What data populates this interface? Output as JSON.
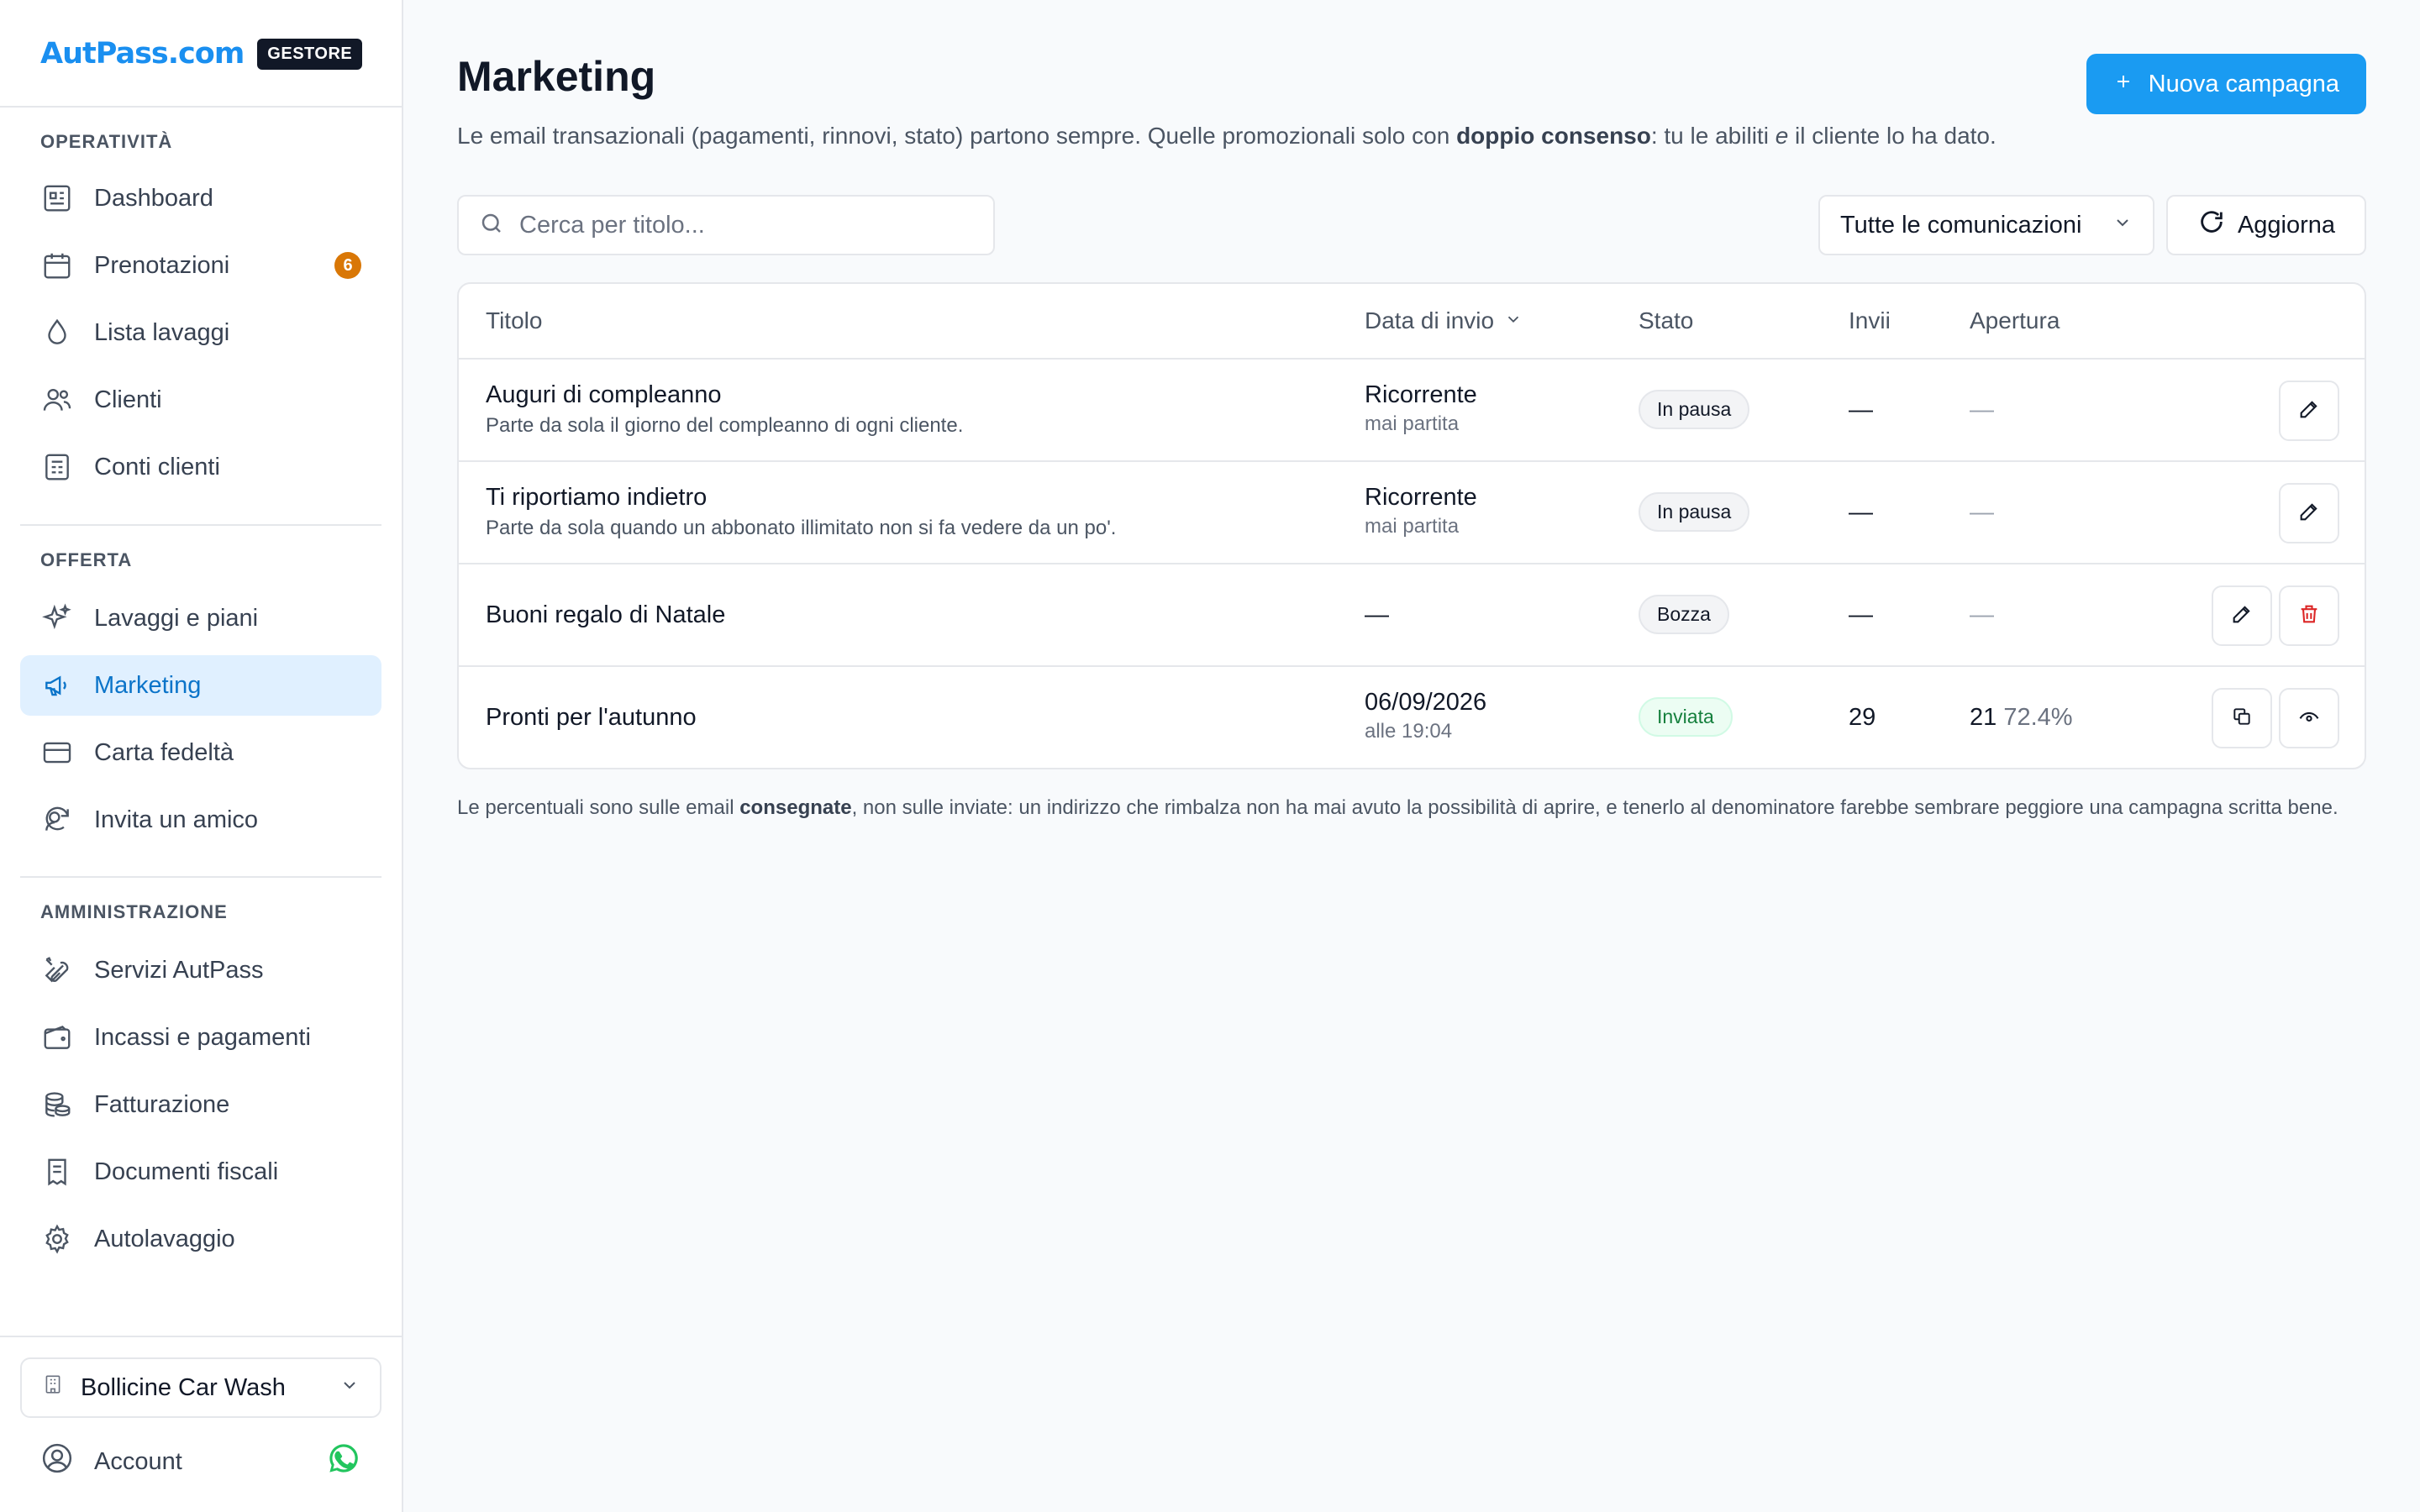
{
  "brand": {
    "logo": "AutPass.com",
    "badge": "GESTORE"
  },
  "sidebar": {
    "sections": [
      {
        "label": "OPERATIVITÀ",
        "items": [
          {
            "label": "Dashboard",
            "icon": "dashboard-icon"
          },
          {
            "label": "Prenotazioni",
            "icon": "calendar-icon",
            "badge": "6"
          },
          {
            "label": "Lista lavaggi",
            "icon": "droplet-icon"
          },
          {
            "label": "Clienti",
            "icon": "users-icon"
          },
          {
            "label": "Conti clienti",
            "icon": "ledger-icon"
          }
        ]
      },
      {
        "label": "OFFERTA",
        "items": [
          {
            "label": "Lavaggi e piani",
            "icon": "sparkles-icon"
          },
          {
            "label": "Marketing",
            "icon": "megaphone-icon",
            "active": true
          },
          {
            "label": "Carta fedeltà",
            "icon": "credit-card-icon"
          },
          {
            "label": "Invita un amico",
            "icon": "refer-friend-icon"
          }
        ]
      },
      {
        "label": "AMMINISTRAZIONE",
        "items": [
          {
            "label": "Servizi AutPass",
            "icon": "tools-icon"
          },
          {
            "label": "Incassi e pagamenti",
            "icon": "wallet-icon"
          },
          {
            "label": "Fatturazione",
            "icon": "coins-icon"
          },
          {
            "label": "Documenti fiscali",
            "icon": "receipt-icon"
          },
          {
            "label": "Autolavaggio",
            "icon": "gear-icon"
          }
        ]
      }
    ],
    "location": "Bollicine Car Wash",
    "account": "Account"
  },
  "header": {
    "title": "Marketing",
    "subtitle_1": "Le email transazionali (pagamenti, rinnovi, stato) partono sempre. Quelle promozionali solo con ",
    "subtitle_bold": "doppio consenso",
    "subtitle_2": ": tu le abiliti ",
    "subtitle_italic": "e",
    "subtitle_3": " il cliente lo ha dato.",
    "new_button": "Nuova campagna"
  },
  "toolbar": {
    "search_placeholder": "Cerca per titolo...",
    "filter": "Tutte le comunicazioni",
    "refresh": "Aggiorna"
  },
  "table": {
    "columns": [
      "Titolo",
      "Data di invio",
      "Stato",
      "Invii",
      "Apertura"
    ],
    "rows": [
      {
        "title": "Auguri di compleanno",
        "subtitle": "Parte da sola il giorno del compleanno di ogni cliente.",
        "date": "Ricorrente",
        "date_sub": "mai partita",
        "status": "In pausa",
        "sent": "—",
        "open": "—"
      },
      {
        "title": "Ti riportiamo indietro",
        "subtitle": "Parte da sola quando un abbonato illimitato non si fa vedere da un po'.",
        "date": "Ricorrente",
        "date_sub": "mai partita",
        "status": "In pausa",
        "sent": "—",
        "open": "—"
      },
      {
        "title": "Buoni regalo di Natale",
        "subtitle": "",
        "date": "—",
        "date_sub": "",
        "status": "Bozza",
        "sent": "—",
        "open": "—"
      },
      {
        "title": "Pronti per l'autunno",
        "subtitle": "",
        "date": "06/09/2026",
        "date_sub": "alle 19:04",
        "status": "Inviata",
        "sent": "29",
        "open": "21",
        "open_pct": "72.4%"
      }
    ]
  },
  "footnote": {
    "part_1": "Le percentuali sono sulle email ",
    "bold": "consegnate",
    "part_2": ", non sulle inviate: un indirizzo che rimbalza non ha mai avuto la possibilità di aprire, e tenerlo al denominatore farebbe sembrare peggiore una campagna scritta bene."
  },
  "colors": {
    "accent": "#1a9bf2",
    "brand": "#1a8ff0",
    "active_bg": "#e0f0ff",
    "badge_orange": "#d97706",
    "sent_green": "#15803d",
    "danger": "#dc2626",
    "whatsapp": "#22c55e"
  }
}
